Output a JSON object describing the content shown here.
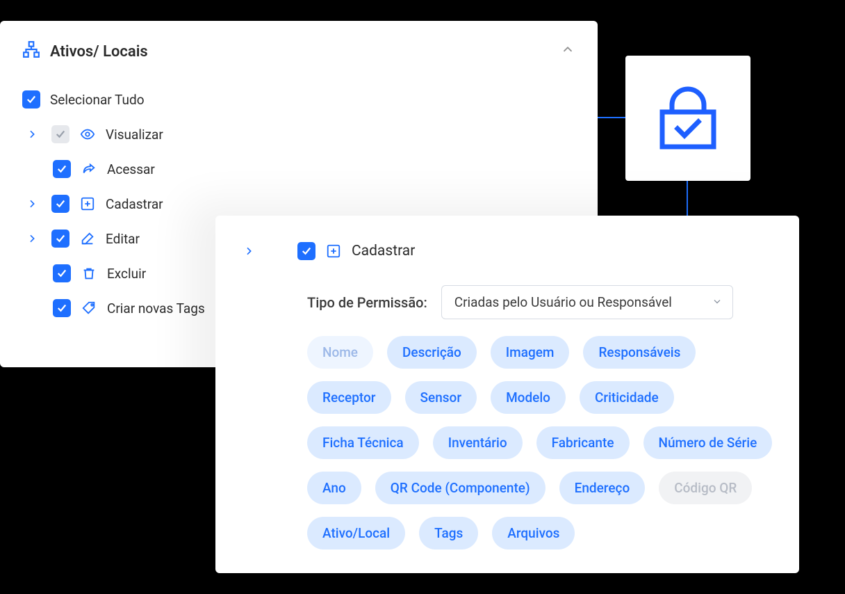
{
  "section": {
    "title": "Ativos/ Locais"
  },
  "tree": {
    "selectAll": "Selecionar Tudo",
    "items": [
      {
        "label": "Visualizar"
      },
      {
        "label": "Acessar"
      },
      {
        "label": "Cadastrar"
      },
      {
        "label": "Editar"
      },
      {
        "label": "Excluir"
      },
      {
        "label": "Criar novas Tags"
      }
    ]
  },
  "detail": {
    "node": "Cadastrar",
    "permissionTypeLabel": "Tipo de Permissão:",
    "permissionTypeValue": "Criadas pelo Usuário ou Responsável",
    "chips": [
      {
        "text": "Nome",
        "state": "muted"
      },
      {
        "text": "Descrição",
        "state": "on"
      },
      {
        "text": "Imagem",
        "state": "on"
      },
      {
        "text": "Responsáveis",
        "state": "on"
      },
      {
        "text": "Receptor",
        "state": "on"
      },
      {
        "text": "Sensor",
        "state": "on"
      },
      {
        "text": "Modelo",
        "state": "on"
      },
      {
        "text": "Criticidade",
        "state": "on"
      },
      {
        "text": "Ficha Técnica",
        "state": "on"
      },
      {
        "text": "Inventário",
        "state": "on"
      },
      {
        "text": "Fabricante",
        "state": "on"
      },
      {
        "text": "Número de Série",
        "state": "on"
      },
      {
        "text": "Ano",
        "state": "on"
      },
      {
        "text": "QR Code (Componente)",
        "state": "on"
      },
      {
        "text": "Endereço",
        "state": "on"
      },
      {
        "text": "Código QR",
        "state": "disabled"
      },
      {
        "text": "Ativo/Local",
        "state": "on"
      },
      {
        "text": "Tags",
        "state": "on"
      },
      {
        "text": "Arquivos",
        "state": "on"
      }
    ]
  }
}
